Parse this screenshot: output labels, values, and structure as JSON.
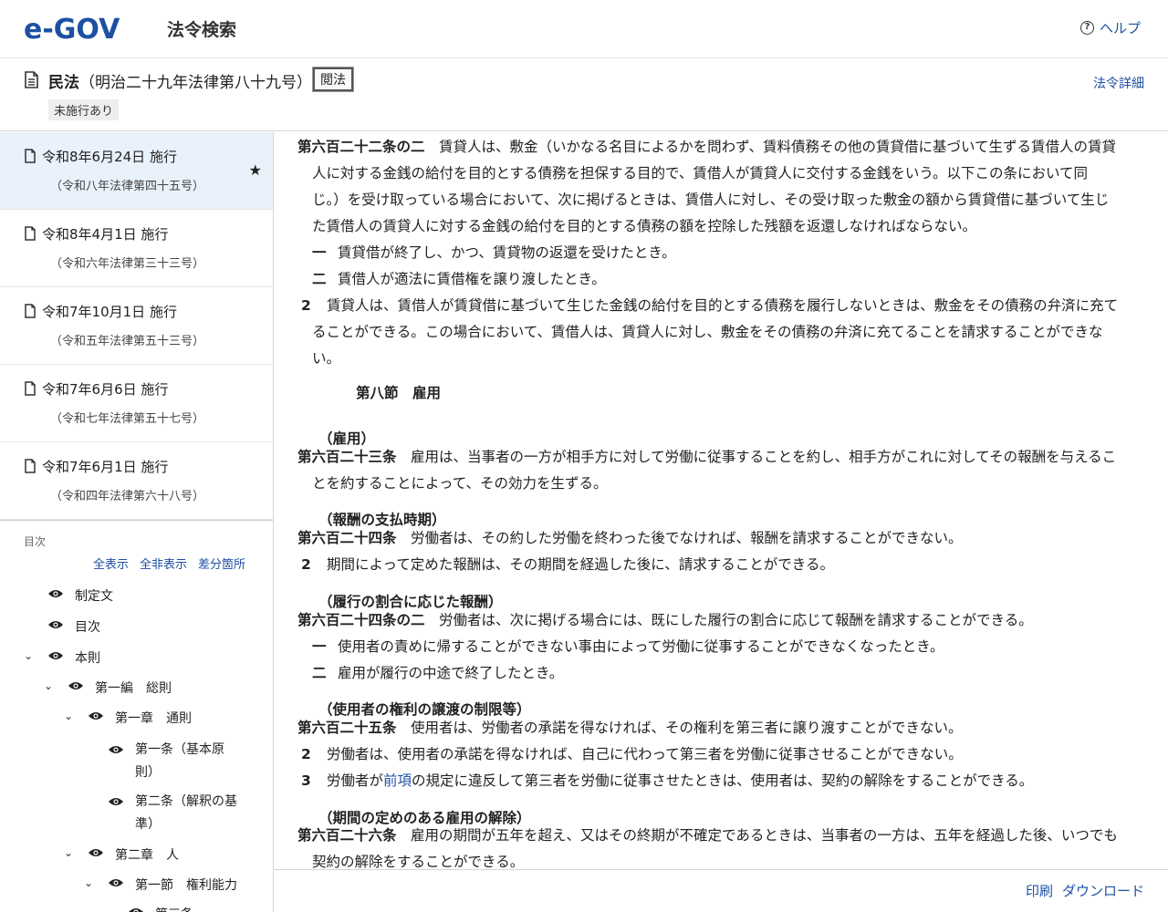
{
  "header": {
    "logo": "e-GOV",
    "site_title": "法令検索",
    "help_label": "ヘルプ"
  },
  "law": {
    "name": "民法",
    "number": "（明治二十九年法律第八十九号）",
    "abbr_button": "閲法",
    "status": "未施行あり",
    "detail_link": "法令詳細"
  },
  "versions": [
    {
      "date": "令和8年6月24日 施行",
      "law": "（令和八年法律第四十五号）",
      "starred": true
    },
    {
      "date": "令和8年4月1日 施行",
      "law": "（令和六年法律第三十三号）"
    },
    {
      "date": "令和7年10月1日 施行",
      "law": "（令和五年法律第五十三号）"
    },
    {
      "date": "令和7年6月6日 施行",
      "law": "（令和七年法律第五十七号）"
    },
    {
      "date": "令和7年6月1日 施行",
      "law": "（令和四年法律第六十八号）"
    }
  ],
  "toc": {
    "label": "目次",
    "show_all": "全表示",
    "hide_all": "全非表示",
    "diff": "差分箇所",
    "items": [
      {
        "label": "制定文"
      },
      {
        "label": "目次"
      },
      {
        "label": "本則"
      },
      {
        "label": "第一編　総則"
      },
      {
        "label": "第一章　通則"
      },
      {
        "label": "第一条（基本原則）",
        "line1": "第一条（基本原",
        "line2": "則）"
      },
      {
        "label": "第二条（解釈の基準）",
        "line1": "第二条（解釈の基",
        "line2": "準）"
      },
      {
        "label": "第二章　人"
      },
      {
        "label": "第一節　権利能力"
      },
      {
        "label": "第三条"
      }
    ]
  },
  "content": {
    "a622_2_title": "第六百二十二条の二",
    "a622_2_l1": "賃貸人は、敷金（いかなる名目によるかを問わず、賃料債務その他の賃貸借に基づいて生ずる賃借人の賃貸",
    "a622_2_l2": "人に対する金銭の給付を目的とする債務を担保する目的で、賃借人が賃貸人に交付する金銭をいう。以下この条において同",
    "a622_2_l3": "じ。）を受け取っている場合において、次に掲げるときは、賃借人に対し、その受け取った敷金の額から賃貸借に基づいて生じ",
    "a622_2_l4": "た賃借人の賃貸人に対する金銭の給付を目的とする債務の額を控除した残額を返還しなければならない。",
    "a622_2_i1_num": "一",
    "a622_2_i1": "賃貸借が終了し、かつ、賃貸物の返還を受けたとき。",
    "a622_2_i2_num": "二",
    "a622_2_i2": "賃借人が適法に賃借権を譲り渡したとき。",
    "a622_2_p2_num": "2",
    "a622_2_p2_l1": "賃貸人は、賃借人が賃貸借に基づいて生じた金銭の給付を目的とする債務を履行しないときは、敷金をその債務の弁済に充て",
    "a622_2_p2_l2": "ることができる。この場合において、賃借人は、賃貸人に対し、敷金をその債務の弁済に充てることを請求することができな",
    "a622_2_p2_l3": "い。",
    "section8": "第八節　雇用",
    "a623_cap": "（雇用）",
    "a623_title": "第六百二十三条",
    "a623_l1": "雇用は、当事者の一方が相手方に対して労働に従事することを約し、相手方がこれに対してその報酬を与えるこ",
    "a623_l2": "とを約することによって、その効力を生ずる。",
    "a624_cap": "（報酬の支払時期）",
    "a624_title": "第六百二十四条",
    "a624_l1": "労働者は、その約した労働を終わった後でなければ、報酬を請求することができない。",
    "a624_p2_num": "2",
    "a624_p2": "期間によって定めた報酬は、その期間を経過した後に、請求することができる。",
    "a624_2_cap": "（履行の割合に応じた報酬）",
    "a624_2_title": "第六百二十四条の二",
    "a624_2_l1": "労働者は、次に掲げる場合には、既にした履行の割合に応じて報酬を請求することができる。",
    "a624_2_i1_num": "一",
    "a624_2_i1": "使用者の責めに帰することができない事由によって労働に従事することができなくなったとき。",
    "a624_2_i2_num": "二",
    "a624_2_i2": "雇用が履行の中途で終了したとき。",
    "a625_cap": "（使用者の権利の譲渡の制限等）",
    "a625_title": "第六百二十五条",
    "a625_l1": "使用者は、労働者の承諾を得なければ、その権利を第三者に譲り渡すことができない。",
    "a625_p2_num": "2",
    "a625_p2": "労働者は、使用者の承諾を得なければ、自己に代わって第三者を労働に従事させることができない。",
    "a625_p3_num": "3",
    "a625_p3_pre": "労働者が",
    "a625_p3_link": "前項",
    "a625_p3_post": "の規定に違反して第三者を労働に従事させたときは、使用者は、契約の解除をすることができる。",
    "a626_cap": "（期間の定めのある雇用の解除）",
    "a626_title": "第六百二十六条",
    "a626_l1": "雇用の期間が五年を超え、又はその終期が不確定であるときは、当事者の一方は、五年を経過した後、いつでも",
    "a626_l2": "契約の解除をすることができる。"
  },
  "footer": {
    "print": "印刷",
    "download": "ダウンロード"
  }
}
